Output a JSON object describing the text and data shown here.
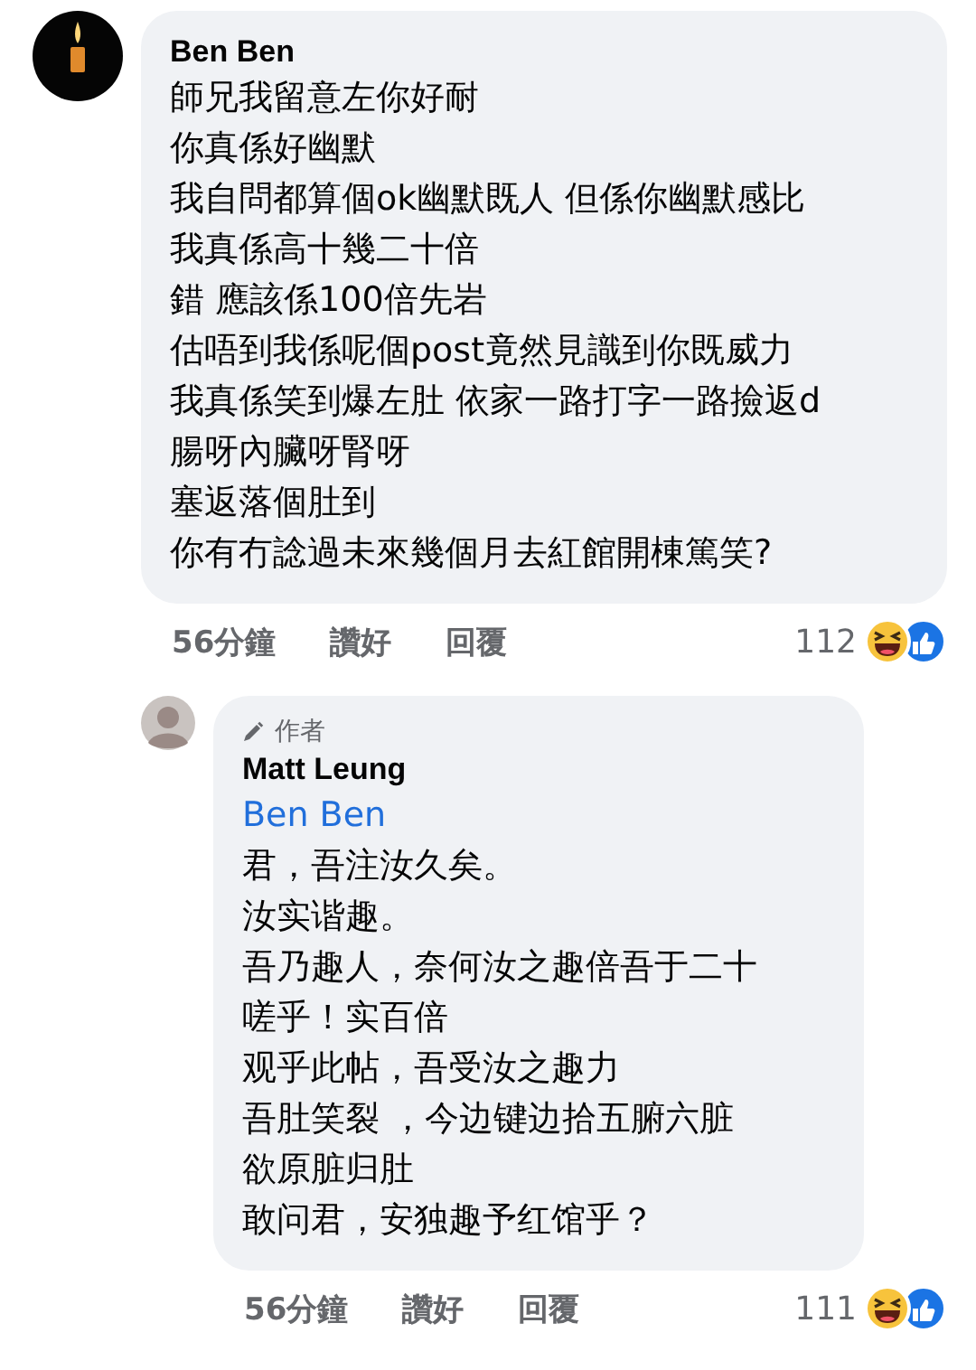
{
  "comments": [
    {
      "avatar": {
        "kind": "candle"
      },
      "author": "Ben Ben",
      "lines": [
        "師兄我留意左你好耐",
        "你真係好幽默",
        "我自問都算個ok幽默既人 但係你幽默感比",
        "我真係高十幾二十倍",
        "錯 應該係100倍先岩",
        "估唔到我係呢個post竟然見識到你既威力",
        "我真係笑到爆左肚 依家一路打字一路撿返d",
        "腸呀內臟呀腎呀",
        "塞返落個肚到",
        "你有冇諗過未來幾個月去紅館開棟篤笑?"
      ],
      "time": "56分鐘",
      "like": "讚好",
      "reply": "回覆",
      "reaction_count": "112",
      "replies": [
        {
          "avatar": {
            "kind": "person"
          },
          "badge": "作者",
          "author": "Matt Leung",
          "mention": "Ben Ben",
          "lines": [
            "君，吾注汝久矣。",
            "汝实谐趣。",
            "吾乃趣人，奈何汝之趣倍吾于二十",
            "嗟乎！实百倍",
            "观乎此帖，吾受汝之趣力",
            "吾肚笑裂 ，今边键边拾五腑六脏",
            "欲原脏归肚",
            "敢问君，安独趣予红馆乎？"
          ],
          "time": "56分鐘",
          "like": "讚好",
          "reply": "回覆",
          "reaction_count": "111"
        }
      ]
    }
  ]
}
